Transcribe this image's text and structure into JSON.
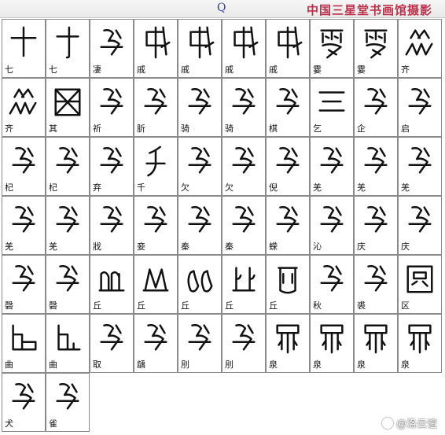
{
  "header": {
    "letter": "Q",
    "title": "中国三星堂书画馆摄影"
  },
  "cells": [
    {
      "label": "七",
      "glyph": "cross"
    },
    {
      "label": "七",
      "glyph": "cross2"
    },
    {
      "label": "凄",
      "glyph": "scribble"
    },
    {
      "label": "戚",
      "glyph": "axe"
    },
    {
      "label": "戚",
      "glyph": "axe"
    },
    {
      "label": "戚",
      "glyph": "axe"
    },
    {
      "label": "戚",
      "glyph": "axe"
    },
    {
      "label": "霎",
      "glyph": "rain"
    },
    {
      "label": "霎",
      "glyph": "rain"
    },
    {
      "label": "齐",
      "glyph": "peaks"
    },
    {
      "label": "齐",
      "glyph": "peaks"
    },
    {
      "label": "其",
      "glyph": "basket"
    },
    {
      "label": "祈",
      "glyph": "scribble"
    },
    {
      "label": "肵",
      "glyph": "scribble"
    },
    {
      "label": "骑",
      "glyph": "scribble"
    },
    {
      "label": "骑",
      "glyph": "scribble"
    },
    {
      "label": "棋",
      "glyph": "scribble"
    },
    {
      "label": "乞",
      "glyph": "three"
    },
    {
      "label": "企",
      "glyph": "scribble"
    },
    {
      "label": "启",
      "glyph": "scribble"
    },
    {
      "label": "杞",
      "glyph": "scribble"
    },
    {
      "label": "杞",
      "glyph": "scribble"
    },
    {
      "label": "弃",
      "glyph": "scribble"
    },
    {
      "label": "千",
      "glyph": "person"
    },
    {
      "label": "欠",
      "glyph": "scribble"
    },
    {
      "label": "欠",
      "glyph": "scribble"
    },
    {
      "label": "倪",
      "glyph": "scribble"
    },
    {
      "label": "羌",
      "glyph": "scribble"
    },
    {
      "label": "羌",
      "glyph": "scribble"
    },
    {
      "label": "羌",
      "glyph": "scribble"
    },
    {
      "label": "羌",
      "glyph": "scribble"
    },
    {
      "label": "羌",
      "glyph": "scribble"
    },
    {
      "label": "戕",
      "glyph": "scribble"
    },
    {
      "label": "妾",
      "glyph": "scribble"
    },
    {
      "label": "秦",
      "glyph": "scribble"
    },
    {
      "label": "秦",
      "glyph": "scribble"
    },
    {
      "label": "蝾",
      "glyph": "scribble"
    },
    {
      "label": "沁",
      "glyph": "scribble"
    },
    {
      "label": "庆",
      "glyph": "scribble"
    },
    {
      "label": "庆",
      "glyph": "scribble"
    },
    {
      "label": "磬",
      "glyph": "scribble"
    },
    {
      "label": "磬",
      "glyph": "scribble"
    },
    {
      "label": "丘",
      "glyph": "hills"
    },
    {
      "label": "丘",
      "glyph": "hills2"
    },
    {
      "label": "丘",
      "glyph": "ears"
    },
    {
      "label": "丘",
      "glyph": "ears2"
    },
    {
      "label": "丘",
      "glyph": "pot"
    },
    {
      "label": "秋",
      "glyph": "scribble"
    },
    {
      "label": "裘",
      "glyph": "scribble"
    },
    {
      "label": "区",
      "glyph": "box"
    },
    {
      "label": "曲",
      "glyph": "ell"
    },
    {
      "label": "曲",
      "glyph": "ell2"
    },
    {
      "label": "取",
      "glyph": "scribble"
    },
    {
      "label": "龋",
      "glyph": "scribble"
    },
    {
      "label": "刖",
      "glyph": "scribble"
    },
    {
      "label": "刖",
      "glyph": "scribble"
    },
    {
      "label": "泉",
      "glyph": "spring"
    },
    {
      "label": "泉",
      "glyph": "spring"
    },
    {
      "label": "泉",
      "glyph": "spring"
    },
    {
      "label": "泉",
      "glyph": "spring"
    },
    {
      "label": "犬",
      "glyph": "scribble"
    },
    {
      "label": "雀",
      "glyph": "scribble"
    }
  ],
  "watermark": {
    "text": "@洛云谊"
  }
}
